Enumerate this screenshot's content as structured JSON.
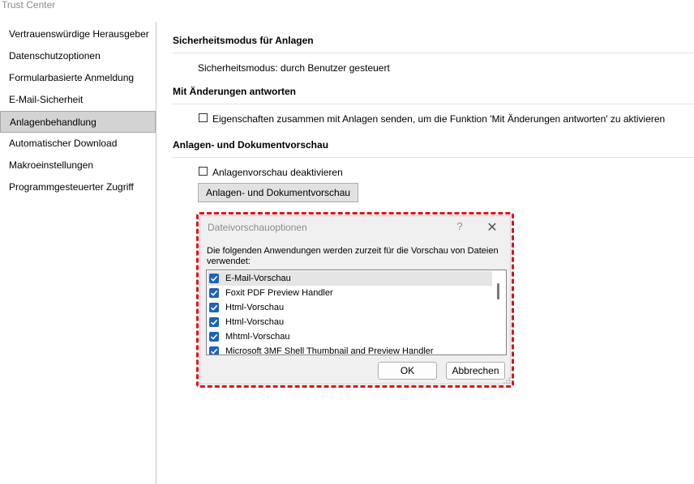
{
  "window": {
    "title": "Trust Center"
  },
  "sidebar": {
    "items": [
      {
        "label": "Vertrauenswürdige Herausgeber",
        "active": false
      },
      {
        "label": "Datenschutzoptionen",
        "active": false
      },
      {
        "label": "Formularbasierte Anmeldung",
        "active": false
      },
      {
        "label": "E-Mail-Sicherheit",
        "active": false
      },
      {
        "label": "Anlagenbehandlung",
        "active": true
      },
      {
        "label": "Automatischer Download",
        "active": false
      },
      {
        "label": "Makroeinstellungen",
        "active": false
      },
      {
        "label": "Programmgesteuerter Zugriff",
        "active": false
      }
    ]
  },
  "main": {
    "section1": {
      "heading": "Sicherheitsmodus für Anlagen",
      "text": "Sicherheitsmodus: durch Benutzer gesteuert"
    },
    "section2": {
      "heading": "Mit Änderungen antworten",
      "checkbox": {
        "label": "Eigenschaften zusammen mit Anlagen senden, um die Funktion 'Mit Änderungen antworten' zu aktivieren",
        "checked": false
      }
    },
    "section3": {
      "heading": "Anlagen- und Dokumentvorschau",
      "checkbox": {
        "label": "Anlagenvorschau deaktivieren",
        "checked": false
      },
      "button_label": "Anlagen- und Dokumentvorschau"
    }
  },
  "dialog": {
    "title": "Dateivorschauoptionen",
    "help": "?",
    "close": "✕",
    "description": "Die folgenden Anwendungen werden zurzeit für die Vorschau von Dateien verwendet:",
    "items": [
      {
        "label": "E-Mail-Vorschau",
        "checked": true,
        "selected": true
      },
      {
        "label": "Foxit PDF Preview Handler",
        "checked": true,
        "selected": false
      },
      {
        "label": "Html-Vorschau",
        "checked": true,
        "selected": false
      },
      {
        "label": "Html-Vorschau",
        "checked": true,
        "selected": false
      },
      {
        "label": "Mhtml-Vorschau",
        "checked": true,
        "selected": false
      },
      {
        "label": "Microsoft 3MF Shell Thumbnail and Preview Handler",
        "checked": true,
        "selected": false
      }
    ],
    "ok_label": "OK",
    "cancel_label": "Abbrechen"
  },
  "colors": {
    "accent": "#1c62b9",
    "highlight": "#e0101a",
    "nav_active": "#d3d3d3"
  }
}
